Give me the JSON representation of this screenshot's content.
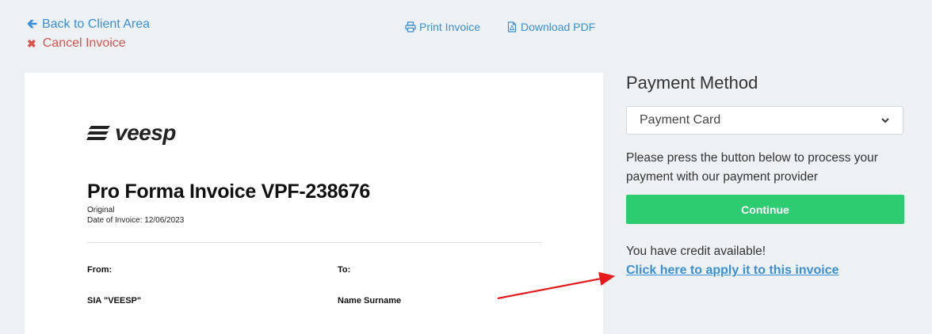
{
  "nav": {
    "back_label": "Back to Client Area",
    "cancel_label": "Cancel Invoice",
    "print_label": "Print Invoice",
    "download_label": "Download PDF"
  },
  "invoice": {
    "logo_text": "veesp",
    "title": "Pro Forma Invoice VPF-238676",
    "status": "Original",
    "date": "Date of Invoice: 12/06/2023",
    "from_label": "From:",
    "to_label": "To:",
    "from_name": "SIA \"VEESP\"",
    "to_name": "Name Surname"
  },
  "payment": {
    "title": "Payment Method",
    "selected_method": "Payment Card",
    "description": "Please press the button below to process your payment with our payment provider",
    "continue_label": "Continue",
    "credit_text": "You have credit available!",
    "credit_link": "Click here to apply it to this invoice"
  },
  "colors": {
    "link": "#3a8fd6",
    "danger": "#d9534f",
    "success": "#2ecc71",
    "annotation": "#e8191a"
  }
}
